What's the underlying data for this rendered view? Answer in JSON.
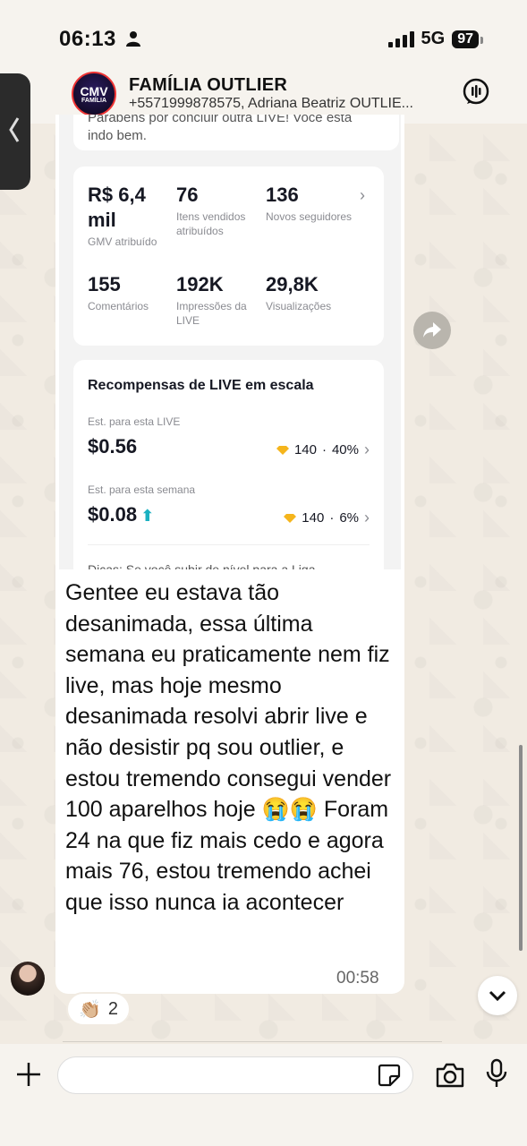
{
  "status_bar": {
    "time": "06:13",
    "network": "5G",
    "battery": "97"
  },
  "header": {
    "avatar_text": "CMV",
    "avatar_subtext": "FAMÍLIA",
    "title": "FAMÍLIA OUTLIER",
    "members": "+5571999878575, Adriana Beatriz OUTLIE..."
  },
  "shared_screenshot": {
    "congrats_text": "Parabéns por concluir outra LIVE! Você está indo bem.",
    "stats": [
      {
        "value": "R$ 6,4 mil",
        "label": "GMV atribuído"
      },
      {
        "value": "76",
        "label": "Itens vendidos atribuídos"
      },
      {
        "value": "136",
        "label": "Novos seguidores"
      },
      {
        "value": "155",
        "label": "Comentários"
      },
      {
        "value": "192K",
        "label": "Impressões da LIVE"
      },
      {
        "value": "29,8K",
        "label": "Visualizações"
      }
    ],
    "rewards": {
      "title": "Recompensas de LIVE em escala",
      "live_label": "Est. para esta LIVE",
      "live_amount": "$0.56",
      "live_diamonds": "140",
      "live_percent": "40%",
      "week_label": "Est. para esta semana",
      "week_amount": "$0.08",
      "week_diamonds": "140",
      "week_percent": "6%",
      "tip": "Dicas: Se você subir de nível para a Liga"
    }
  },
  "message": {
    "text": "Gentee eu estava tão desanimada, essa última semana eu praticamente nem fiz live, mas hoje mesmo desanimada resolvi abrir live e não desistir pq sou outlier, e estou tremendo consegui vender 100 aparelhos hoje 😭😭 Foram 24 na que fiz mais cedo e agora mais 76, estou tremendo achei que isso nunca ia acontecer",
    "time": "00:58",
    "reaction_emoji": "👏🏼",
    "reaction_count": "2"
  },
  "input": {
    "placeholder": ""
  }
}
